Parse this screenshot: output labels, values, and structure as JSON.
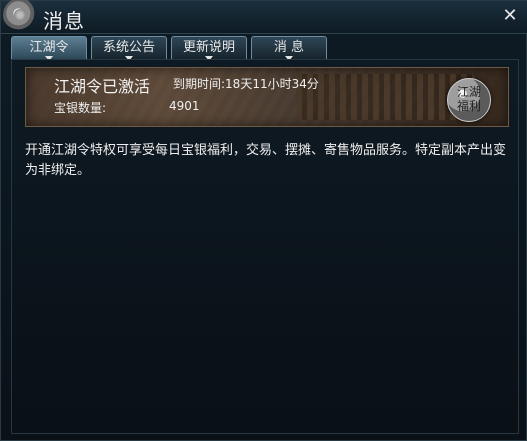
{
  "window": {
    "title": "消息",
    "close_icon": "close-icon",
    "gear_icon": "gear-icon"
  },
  "tabs": [
    {
      "label": "江湖令",
      "active": true
    },
    {
      "label": "系统公告",
      "active": false
    },
    {
      "label": "更新说明",
      "active": false
    },
    {
      "label": "消 息",
      "active": false
    }
  ],
  "banner": {
    "title": "江湖令已激活",
    "expiry_label": "到期时间:",
    "expiry_value": "18天11小时34分",
    "silver_label": "宝银数量:",
    "silver_value": "4901",
    "seal_text_1": "江湖",
    "seal_text_2": "福利"
  },
  "description": "开通江湖令特权可享受每日宝银福利，交易、摆摊、寄售物品服务。特定副本产出变为非绑定。"
}
